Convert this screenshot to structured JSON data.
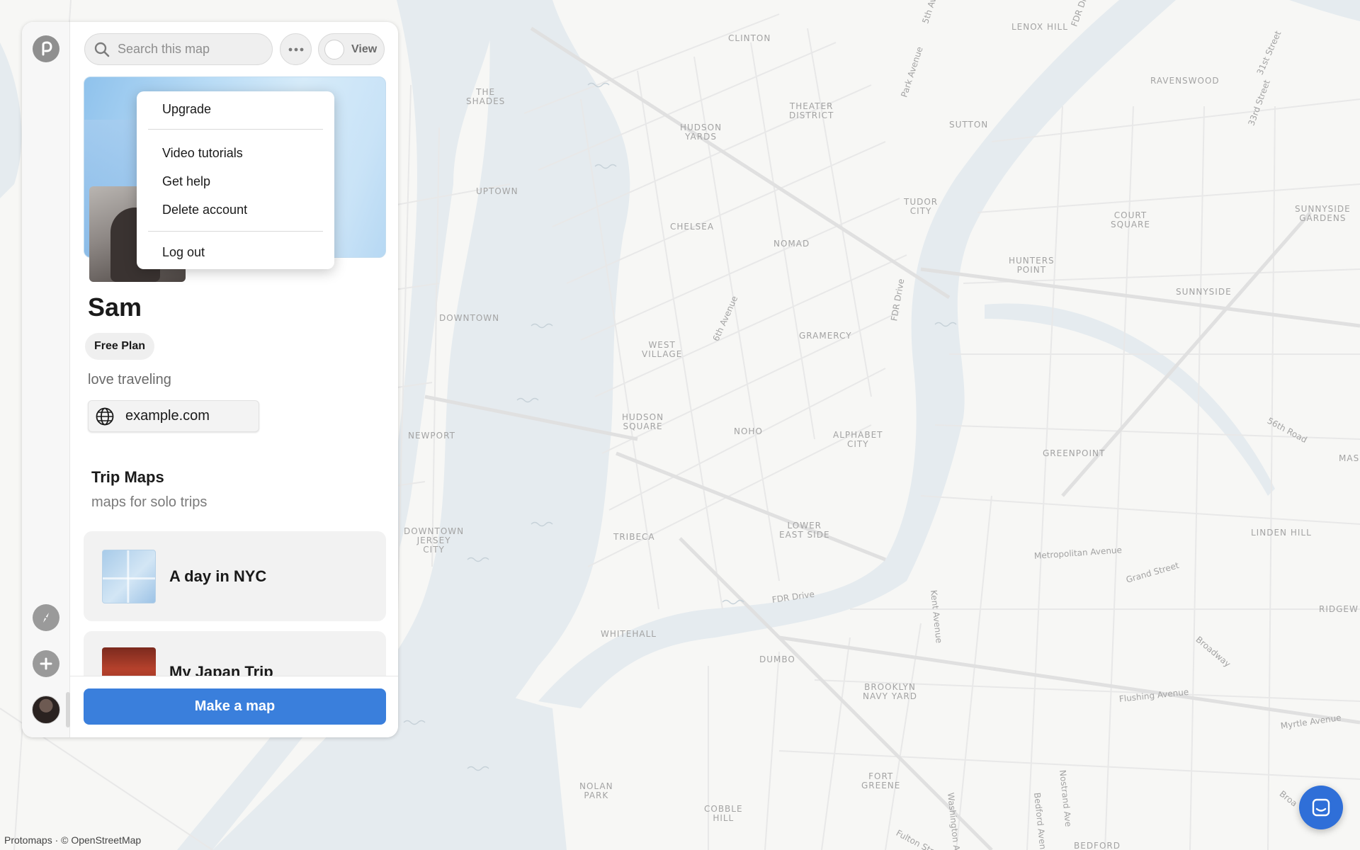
{
  "map": {
    "attribution": "Protomaps · © OpenStreetMap",
    "neighborhoods": [
      {
        "id": "clinton",
        "text": "CLINTON"
      },
      {
        "id": "lenox-hill",
        "text": "LENOX HILL"
      },
      {
        "id": "ravenswood",
        "text": "RAVENSWOOD"
      },
      {
        "id": "the-shades",
        "text": "THE\nSHADES"
      },
      {
        "id": "theater-district",
        "text": "THEATER\nDISTRICT"
      },
      {
        "id": "hudson-yards",
        "text": "HUDSON\nYARDS"
      },
      {
        "id": "sutton",
        "text": "SUTTON"
      },
      {
        "id": "uptown",
        "text": "UPTOWN"
      },
      {
        "id": "tudor-city",
        "text": "TUDOR\nCITY"
      },
      {
        "id": "court-square",
        "text": "COURT\nSQUARE"
      },
      {
        "id": "sunnyside-gardens",
        "text": "SUNNYSIDE\nGARDENS"
      },
      {
        "id": "chelsea",
        "text": "CHELSEA"
      },
      {
        "id": "nomad",
        "text": "NOMAD"
      },
      {
        "id": "hunters-point",
        "text": "HUNTERS\nPOINT"
      },
      {
        "id": "sunnyside",
        "text": "SUNNYSIDE"
      },
      {
        "id": "downtown",
        "text": "DOWNTOWN"
      },
      {
        "id": "gramercy",
        "text": "GRAMERCY"
      },
      {
        "id": "west-village",
        "text": "WEST\nVILLAGE"
      },
      {
        "id": "hudson-square",
        "text": "HUDSON\nSQUARE"
      },
      {
        "id": "noho",
        "text": "NOHO"
      },
      {
        "id": "alphabet-city",
        "text": "ALPHABET\nCITY"
      },
      {
        "id": "newport",
        "text": "NEWPORT"
      },
      {
        "id": "greenpoint",
        "text": "GREENPOINT"
      },
      {
        "id": "downtown-jersey-city",
        "text": "DOWNTOWN\nJERSEY\nCITY"
      },
      {
        "id": "tribeca",
        "text": "TRIBECA"
      },
      {
        "id": "lower-east-side",
        "text": "LOWER\nEAST SIDE"
      },
      {
        "id": "linden-hill",
        "text": "LINDEN HILL"
      },
      {
        "id": "whitehall",
        "text": "WHITEHALL"
      },
      {
        "id": "dumbo",
        "text": "DUMBO"
      },
      {
        "id": "ridgew",
        "text": "RIDGEW"
      },
      {
        "id": "mas",
        "text": "MAS"
      },
      {
        "id": "brooklyn-navy-yard",
        "text": "BROOKLYN\nNAVY YARD"
      },
      {
        "id": "fort-greene",
        "text": "FORT\nGREENE"
      },
      {
        "id": "nolan-park",
        "text": "NOLAN\nPARK"
      },
      {
        "id": "cobble-hill",
        "text": "COBBLE\nHILL"
      },
      {
        "id": "bedford",
        "text": "BEDFORD"
      }
    ],
    "streets": [
      {
        "id": "park-avenue",
        "text": "Park Avenue"
      },
      {
        "id": "fifth-ave",
        "text": "5th Av"
      },
      {
        "id": "thirty-first-street",
        "text": "31st Street"
      },
      {
        "id": "thirty-third-street",
        "text": "33rd Street"
      },
      {
        "id": "sixth-avenue",
        "text": "6th Avenue"
      },
      {
        "id": "fdr-drive-north",
        "text": "FDR Drive"
      },
      {
        "id": "fdr-drive-south",
        "text": "FDR Drive"
      },
      {
        "id": "fdr-dr-top",
        "text": "FDR Dr"
      },
      {
        "id": "fifty-sixth-road",
        "text": "56th Road"
      },
      {
        "id": "metropolitan-avenue",
        "text": "Metropolitan Avenue"
      },
      {
        "id": "grand-street",
        "text": "Grand Street"
      },
      {
        "id": "kent-avenue",
        "text": "Kent Avenue"
      },
      {
        "id": "broadway",
        "text": "Broadway"
      },
      {
        "id": "flushing-avenue",
        "text": "Flushing Avenue"
      },
      {
        "id": "myrtle-avenue",
        "text": "Myrtle Avenue"
      },
      {
        "id": "washington-avenue",
        "text": "Washington Avenue"
      },
      {
        "id": "bedford-avenue",
        "text": "Bedford Avenue"
      },
      {
        "id": "nostrand-avenue",
        "text": "Nostrand Ave"
      },
      {
        "id": "fulton-street",
        "text": "Fulton Street"
      },
      {
        "id": "broadway-2",
        "text": "Broa"
      }
    ]
  },
  "colors": {
    "land": "#f7f7f5",
    "water": "#e5ebef",
    "road": "#e6e6e6",
    "accent": "#3a7fdc",
    "chat": "#2f6fd8"
  },
  "rail": {
    "logo_icon": "protomaps-logo-icon",
    "explore_icon": "compass-icon",
    "add_icon": "plus-circle-icon",
    "avatar_icon": "user-avatar"
  },
  "toolbar": {
    "search_placeholder": "Search this map",
    "more_icon": "ellipsis-icon",
    "view_label": "View"
  },
  "menu": {
    "items": [
      {
        "id": "upgrade",
        "label": "Upgrade"
      },
      {
        "id": "video-tutorials",
        "label": "Video tutorials"
      },
      {
        "id": "get-help",
        "label": "Get help"
      },
      {
        "id": "delete-account",
        "label": "Delete account"
      },
      {
        "id": "log-out",
        "label": "Log out"
      }
    ]
  },
  "profile": {
    "name": "Sam",
    "plan": "Free Plan",
    "bio": "love traveling",
    "website": "example.com"
  },
  "collection": {
    "title": "Trip Maps",
    "subtitle": "maps for solo trips",
    "maps": [
      {
        "title": "A day in NYC",
        "thumb": "nyc-map-thumbnail"
      },
      {
        "title": "My Japan Trip",
        "thumb": "japan-photo-thumbnail"
      }
    ]
  },
  "footer": {
    "make_map_label": "Make a map"
  }
}
